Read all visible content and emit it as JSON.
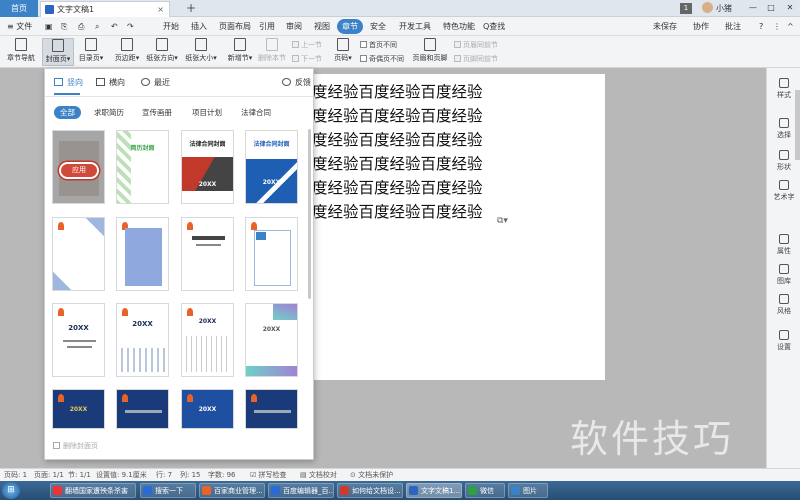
{
  "titlebar": {
    "home_tab": "首页",
    "doc_tab": "文字文稿1",
    "doc_close": "×",
    "new_tab": "+",
    "page_count": "1",
    "user_name": "小猪",
    "min": "—",
    "max": "□",
    "close": "✕"
  },
  "menubar": {
    "file": "≡ 文件",
    "items": [
      "开始",
      "插入",
      "页面布局",
      "引用",
      "审阅",
      "视图",
      "章节",
      "安全",
      "开发工具",
      "特色功能"
    ],
    "active": "章节",
    "search": "Q查找",
    "unsaved": "未保存",
    "collab": "协作",
    "annotate": "批注",
    "help": "?",
    "more": "⋮",
    "collapse": "^"
  },
  "ribbon": {
    "large": [
      {
        "label": "章节导航",
        "dim": false
      },
      {
        "label": "封面页▾",
        "dim": false
      },
      {
        "label": "目录页▾",
        "dim": false
      },
      {
        "label": "页边距▾",
        "dim": false
      },
      {
        "label": "纸张方向▾",
        "dim": false
      },
      {
        "label": "纸张大小▾",
        "dim": false
      },
      {
        "label": "新增节▾",
        "dim": false
      },
      {
        "label": "删除本节",
        "dim": true
      },
      {
        "label": "页码▾",
        "dim": false
      },
      {
        "label": "页眉和页脚",
        "dim": false
      }
    ],
    "small": {
      "prev_section": "上一节",
      "next_section": "下一节",
      "first_diff": "首页不同",
      "odd_even_diff": "奇偶页不同",
      "header_same": "页眉同前节",
      "footer_same": "页脚同前节"
    }
  },
  "document": {
    "lines": [
      "度经验百度经验百度经验",
      "度经验百度经验百度经验",
      "度经验百度经验百度经验",
      "度经验百度经验百度经验",
      "度经验百度经验百度经验",
      "度经验百度经验百度经验"
    ],
    "float_icon": "⧉▾"
  },
  "panel": {
    "tabs": [
      "竖向",
      "横向",
      "最近"
    ],
    "feedback": "反馈",
    "chips": [
      "全部",
      "求职简历",
      "宣传画册",
      "项目计划",
      "法律合同"
    ],
    "thumbs": [
      {
        "title": "",
        "sub": ""
      },
      {
        "title": "简历封面",
        "sub": ""
      },
      {
        "title": "法律合同封面",
        "sub": "20XX"
      },
      {
        "title": "法律合同封面",
        "sub": "20XX"
      },
      {
        "title": "",
        "sub": ""
      },
      {
        "title": "",
        "sub": ""
      },
      {
        "title": "",
        "sub": ""
      },
      {
        "title": "",
        "sub": ""
      },
      {
        "title": "20XX",
        "sub": ""
      },
      {
        "title": "20XX",
        "sub": ""
      },
      {
        "title": "20XX",
        "sub": ""
      },
      {
        "title": "20XX",
        "sub": ""
      },
      {
        "title": "20XX",
        "sub": ""
      },
      {
        "title": "",
        "sub": ""
      },
      {
        "title": "20XX",
        "sub": ""
      },
      {
        "title": "",
        "sub": ""
      }
    ],
    "apply": "应用",
    "delete_cover": "删除封面页"
  },
  "rightbar": {
    "items": [
      "样式",
      "选择",
      "形状",
      "艺术字",
      "属性",
      "图库",
      "风格",
      "设置"
    ]
  },
  "statusbar": {
    "page": "页码: 1",
    "pages": "页面: 1/1",
    "section": "节: 1/1",
    "setting": "设置值: 9.1厘米",
    "row": "行: 7",
    "col": "列: 15",
    "words": "字数: 96",
    "spell": "拼写检查",
    "proof": "文档校对",
    "unprotected": "文档未保护"
  },
  "taskbar": {
    "start": "⊞",
    "items": [
      {
        "label": "翻墙国家遭殃条杀害",
        "color": "#e33"
      },
      {
        "label": "搜索一下",
        "color": "#2a6bd6"
      },
      {
        "label": "百家商业管理...",
        "color": "#e8632a"
      },
      {
        "label": "百度编辑器_百...",
        "color": "#2a6bd6"
      },
      {
        "label": "如何给文档设...",
        "color": "#d13a2a"
      },
      {
        "label": "文字文稿1...",
        "color": "#2b65c1"
      },
      {
        "label": "微信",
        "color": "#2ea043"
      },
      {
        "label": "图片",
        "color": "#3b82c6"
      }
    ]
  },
  "watermark": "软件技巧",
  "colors": {
    "accent": "#3b82c6",
    "brand_red": "#cf4a3a"
  }
}
